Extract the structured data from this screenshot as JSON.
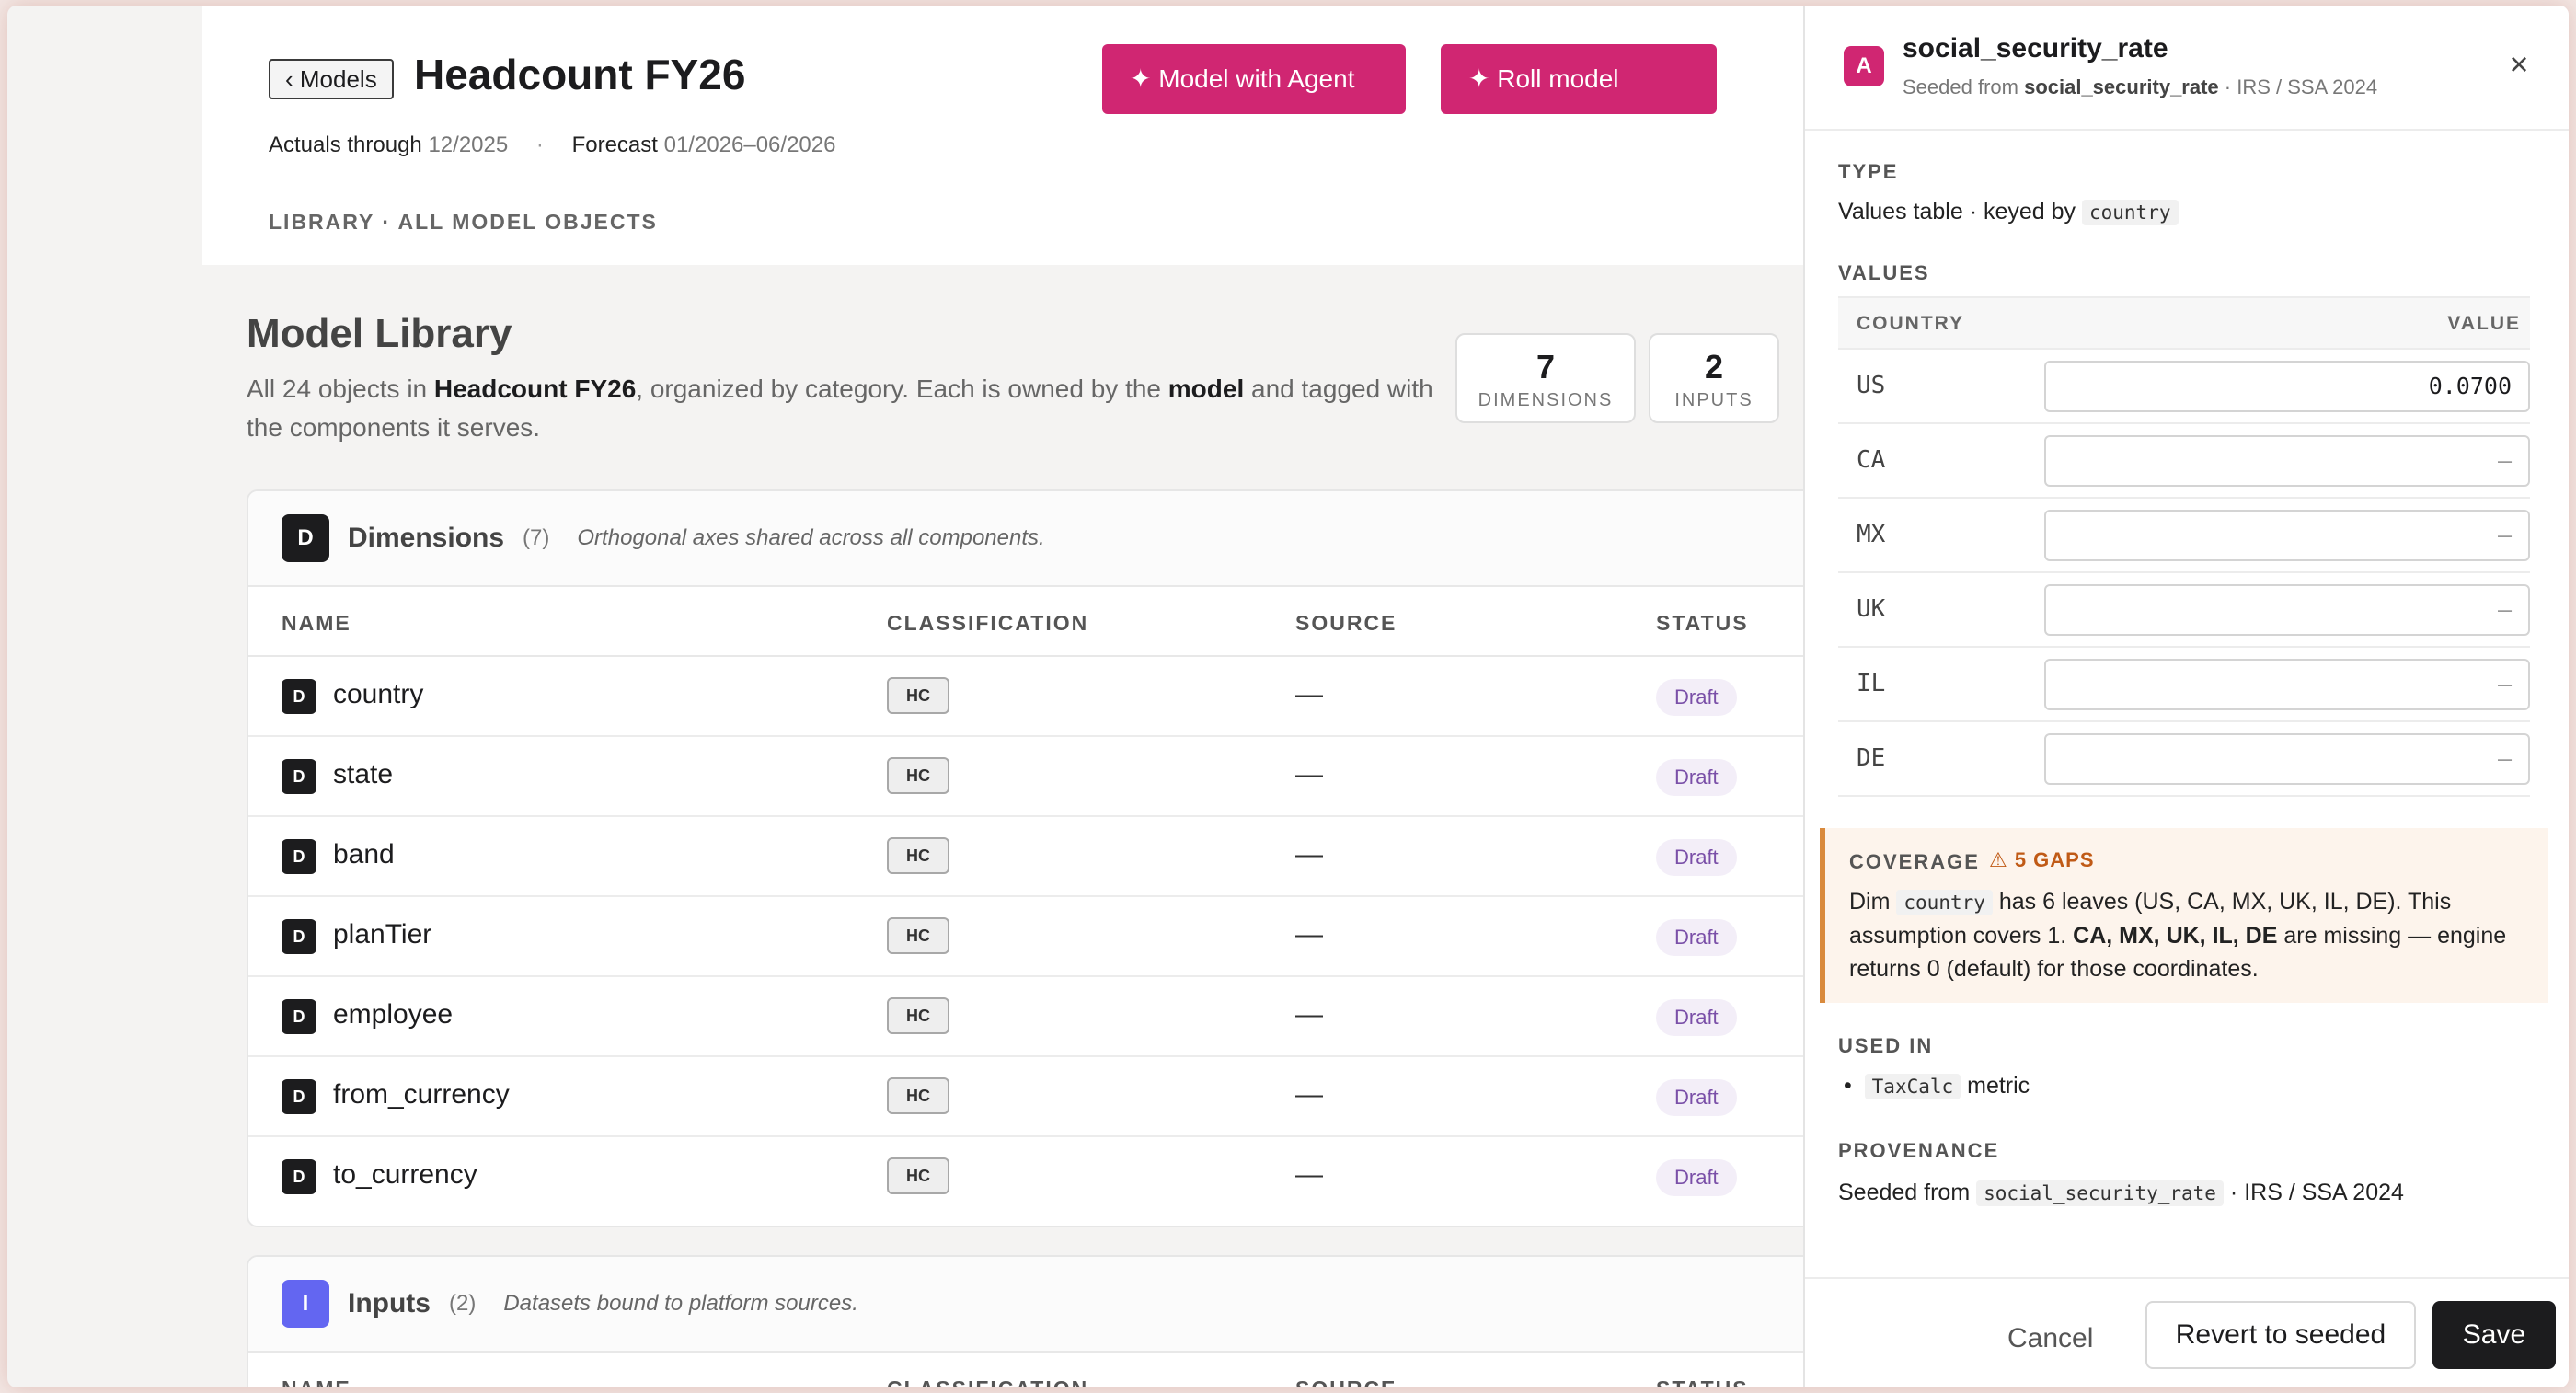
{
  "header": {
    "back_label": "‹ Models",
    "title": "Headcount FY26",
    "actuals_label": "Actuals through",
    "actuals_value": "12/2025",
    "separator": "·",
    "forecast_label": "Forecast",
    "forecast_value": "01/2026–06/2026",
    "breadcrumb": "LIBRARY · ALL MODEL OBJECTS",
    "agent_button": "✦ Model with Agent",
    "roll_button": "✦ Roll model"
  },
  "library": {
    "title": "Model Library",
    "desc_prefix": "All 24 objects in ",
    "desc_model": "Headcount FY26",
    "desc_mid": ", organized by category. Each is owned by the ",
    "desc_owner": "model",
    "desc_suffix": " and tagged with the components it serves.",
    "stats": [
      {
        "num": "7",
        "label": "DIMENSIONS"
      },
      {
        "num": "2",
        "label": "INPUTS"
      }
    ]
  },
  "dimensions_section": {
    "badge": "D",
    "name": "Dimensions",
    "count": "(7)",
    "note": "Orthogonal axes shared across all components.",
    "columns": [
      "NAME",
      "CLASSIFICATION",
      "SOURCE",
      "STATUS"
    ],
    "rows": [
      {
        "icon": "D",
        "name": "country",
        "cls": "HC",
        "source": "—",
        "status": "Draft"
      },
      {
        "icon": "D",
        "name": "state",
        "cls": "HC",
        "source": "—",
        "status": "Draft"
      },
      {
        "icon": "D",
        "name": "band",
        "cls": "HC",
        "source": "—",
        "status": "Draft"
      },
      {
        "icon": "D",
        "name": "planTier",
        "cls": "HC",
        "source": "—",
        "status": "Draft"
      },
      {
        "icon": "D",
        "name": "employee",
        "cls": "HC",
        "source": "—",
        "status": "Draft"
      },
      {
        "icon": "D",
        "name": "from_currency",
        "cls": "HC",
        "source": "—",
        "status": "Draft"
      },
      {
        "icon": "D",
        "name": "to_currency",
        "cls": "HC",
        "source": "—",
        "status": "Draft"
      }
    ]
  },
  "inputs_section": {
    "badge": "I",
    "name": "Inputs",
    "count": "(2)",
    "note": "Datasets bound to platform sources.",
    "columns": [
      "NAME",
      "CLASSIFICATION",
      "SOURCE",
      "STATUS"
    ]
  },
  "drawer": {
    "badge": "A",
    "title": "social_security_rate",
    "sub_prefix": "Seeded from ",
    "sub_bold": "social_security_rate",
    "sub_suffix": " · IRS / SSA 2024",
    "close": "×",
    "type_label": "TYPE",
    "type_text": "Values table · keyed by",
    "type_key": "country",
    "values_label": "VALUES",
    "values_cols": [
      "COUNTRY",
      "VALUE"
    ],
    "values": [
      {
        "key": "US",
        "value": "0.0700"
      },
      {
        "key": "CA",
        "value": "—"
      },
      {
        "key": "MX",
        "value": "—"
      },
      {
        "key": "UK",
        "value": "—"
      },
      {
        "key": "IL",
        "value": "—"
      },
      {
        "key": "DE",
        "value": "—"
      }
    ],
    "coverage_label": "COVERAGE",
    "coverage_gaps": "⚠ 5 GAPS",
    "coverage_dim": "Dim",
    "coverage_key": "country",
    "coverage_text1": "has 6 leaves (US, CA, MX, UK, IL, DE). This assumption covers 1.",
    "coverage_missing": "CA, MX, UK, IL, DE",
    "coverage_text2": "are missing — engine returns 0 (default) for those coordinates.",
    "used_label": "USED IN",
    "used_code": "TaxCalc",
    "used_kind": "metric",
    "prov_label": "PROVENANCE",
    "prov_prefix": "Seeded from",
    "prov_code": "social_security_rate",
    "prov_suffix": "· IRS / SSA 2024",
    "cancel": "Cancel",
    "revert": "Revert to seeded",
    "save": "Save"
  }
}
